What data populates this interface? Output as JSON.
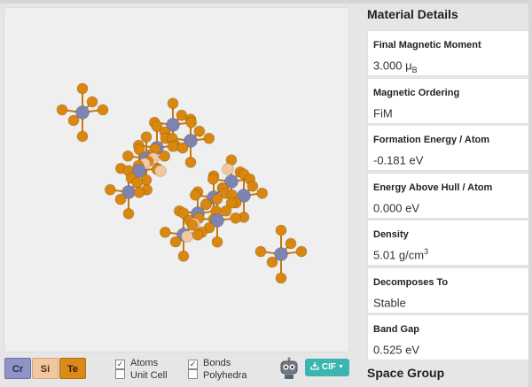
{
  "elements": [
    {
      "symbol": "Cr",
      "color": "#8f93c6"
    },
    {
      "symbol": "Si",
      "color": "#f1c79f"
    },
    {
      "symbol": "Te",
      "color": "#d98a1a"
    }
  ],
  "toggles": {
    "atoms": {
      "label": "Atoms",
      "checked": true
    },
    "bonds": {
      "label": "Bonds",
      "checked": true
    },
    "unit_cell": {
      "label": "Unit Cell",
      "checked": false
    },
    "polyhedra": {
      "label": "Polyhedra",
      "checked": false
    }
  },
  "export_button": {
    "label": "CIF",
    "icon": "download-icon"
  },
  "panel": {
    "title": "Material Details",
    "properties": [
      {
        "label": "Final Magnetic Moment",
        "value": "3.000 μ",
        "sub": "B",
        "sup": ""
      },
      {
        "label": "Magnetic Ordering",
        "value": "FiM",
        "sub": "",
        "sup": ""
      },
      {
        "label": "Formation Energy / Atom",
        "value": "-0.181 eV",
        "sub": "",
        "sup": ""
      },
      {
        "label": "Energy Above Hull / Atom",
        "value": "0.000 eV",
        "sub": "",
        "sup": ""
      },
      {
        "label": "Density",
        "value": "5.01 g/cm",
        "sub": "",
        "sup": "3"
      },
      {
        "label": "Decomposes To",
        "value": "Stable",
        "sub": "",
        "sup": ""
      },
      {
        "label": "Band Gap",
        "value": "0.525 eV",
        "sub": "",
        "sup": ""
      }
    ],
    "next_section": "Space Group"
  },
  "colors": {
    "cr": "#7d84b2",
    "si": "#f1c79f",
    "te": "#d9870f",
    "bond_te": "#c8780f"
  }
}
